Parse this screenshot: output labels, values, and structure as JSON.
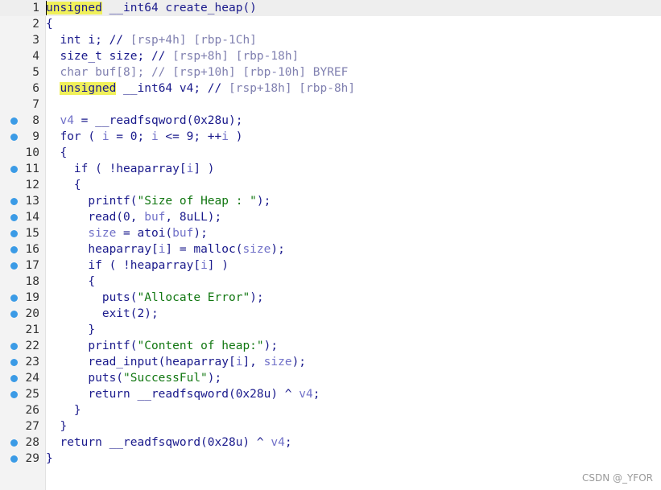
{
  "colors": {
    "gutter_bg": "#f3f3f3",
    "highlight": "#f0f05a",
    "keyword": "#1a1a8c",
    "variable": "#7070c8",
    "string": "#117711",
    "breakpoint": "#3b9be6"
  },
  "lines": [
    {
      "n": "1",
      "bp": false,
      "current": true,
      "parts": [
        [
          "hl",
          "unsigned"
        ],
        [
          "kw",
          " __int64 create_heap()"
        ]
      ]
    },
    {
      "n": "2",
      "bp": false,
      "parts": [
        [
          "kw",
          "{"
        ]
      ]
    },
    {
      "n": "3",
      "bp": false,
      "parts": [
        [
          "kw",
          "  int i; // "
        ],
        [
          "cm",
          "[rsp+4h] [rbp-1Ch]"
        ]
      ]
    },
    {
      "n": "4",
      "bp": false,
      "parts": [
        [
          "kw",
          "  size_t size; // "
        ],
        [
          "cm",
          "[rsp+8h] [rbp-18h]"
        ]
      ]
    },
    {
      "n": "5",
      "bp": false,
      "parts": [
        [
          "cm",
          "  char buf[8]; // [rsp+10h] [rbp-10h] BYREF"
        ]
      ]
    },
    {
      "n": "6",
      "bp": false,
      "parts": [
        [
          "kw",
          "  "
        ],
        [
          "hl",
          "unsigned"
        ],
        [
          "kw",
          " __int64 v4; // "
        ],
        [
          "cm",
          "[rsp+18h] [rbp-8h]"
        ]
      ]
    },
    {
      "n": "7",
      "bp": false,
      "parts": []
    },
    {
      "n": "8",
      "bp": true,
      "parts": [
        [
          "kw",
          "  "
        ],
        [
          "var",
          "v4"
        ],
        [
          "kw",
          " = __readfsqword(0x28u);"
        ]
      ]
    },
    {
      "n": "9",
      "bp": true,
      "parts": [
        [
          "kw",
          "  for ( "
        ],
        [
          "var",
          "i"
        ],
        [
          "kw",
          " = 0; "
        ],
        [
          "var",
          "i"
        ],
        [
          "kw",
          " <= 9; ++"
        ],
        [
          "var",
          "i"
        ],
        [
          "kw",
          " )"
        ]
      ]
    },
    {
      "n": "10",
      "bp": false,
      "parts": [
        [
          "kw",
          "  {"
        ]
      ]
    },
    {
      "n": "11",
      "bp": true,
      "parts": [
        [
          "kw",
          "    if ( !heaparray["
        ],
        [
          "var",
          "i"
        ],
        [
          "kw",
          "] )"
        ]
      ]
    },
    {
      "n": "12",
      "bp": false,
      "parts": [
        [
          "kw",
          "    {"
        ]
      ]
    },
    {
      "n": "13",
      "bp": true,
      "parts": [
        [
          "kw",
          "      printf("
        ],
        [
          "str",
          "\"Size of Heap : \""
        ],
        [
          "kw",
          ");"
        ]
      ]
    },
    {
      "n": "14",
      "bp": true,
      "parts": [
        [
          "kw",
          "      read(0, "
        ],
        [
          "var",
          "buf"
        ],
        [
          "kw",
          ", 8uLL);"
        ]
      ]
    },
    {
      "n": "15",
      "bp": true,
      "parts": [
        [
          "kw",
          "      "
        ],
        [
          "var",
          "size"
        ],
        [
          "kw",
          " = atoi("
        ],
        [
          "var",
          "buf"
        ],
        [
          "kw",
          ");"
        ]
      ]
    },
    {
      "n": "16",
      "bp": true,
      "parts": [
        [
          "kw",
          "      heaparray["
        ],
        [
          "var",
          "i"
        ],
        [
          "kw",
          "] = malloc("
        ],
        [
          "var",
          "size"
        ],
        [
          "kw",
          ");"
        ]
      ]
    },
    {
      "n": "17",
      "bp": true,
      "parts": [
        [
          "kw",
          "      if ( !heaparray["
        ],
        [
          "var",
          "i"
        ],
        [
          "kw",
          "] )"
        ]
      ]
    },
    {
      "n": "18",
      "bp": false,
      "parts": [
        [
          "kw",
          "      {"
        ]
      ]
    },
    {
      "n": "19",
      "bp": true,
      "parts": [
        [
          "kw",
          "        puts("
        ],
        [
          "str",
          "\"Allocate Error\""
        ],
        [
          "kw",
          ");"
        ]
      ]
    },
    {
      "n": "20",
      "bp": true,
      "parts": [
        [
          "kw",
          "        exit(2);"
        ]
      ]
    },
    {
      "n": "21",
      "bp": false,
      "parts": [
        [
          "kw",
          "      }"
        ]
      ]
    },
    {
      "n": "22",
      "bp": true,
      "parts": [
        [
          "kw",
          "      printf("
        ],
        [
          "str",
          "\"Content of heap:\""
        ],
        [
          "kw",
          ");"
        ]
      ]
    },
    {
      "n": "23",
      "bp": true,
      "parts": [
        [
          "kw",
          "      read_input(heaparray["
        ],
        [
          "var",
          "i"
        ],
        [
          "kw",
          "], "
        ],
        [
          "var",
          "size"
        ],
        [
          "kw",
          ");"
        ]
      ]
    },
    {
      "n": "24",
      "bp": true,
      "parts": [
        [
          "kw",
          "      puts("
        ],
        [
          "str",
          "\"SuccessFul\""
        ],
        [
          "kw",
          ");"
        ]
      ]
    },
    {
      "n": "25",
      "bp": true,
      "parts": [
        [
          "kw",
          "      return __readfsqword(0x28u) ^ "
        ],
        [
          "var",
          "v4"
        ],
        [
          "kw",
          ";"
        ]
      ]
    },
    {
      "n": "26",
      "bp": false,
      "parts": [
        [
          "kw",
          "    }"
        ]
      ]
    },
    {
      "n": "27",
      "bp": false,
      "parts": [
        [
          "kw",
          "  }"
        ]
      ]
    },
    {
      "n": "28",
      "bp": true,
      "parts": [
        [
          "kw",
          "  return __readfsqword(0x28u) ^ "
        ],
        [
          "var",
          "v4"
        ],
        [
          "kw",
          ";"
        ]
      ]
    },
    {
      "n": "29",
      "bp": true,
      "parts": [
        [
          "kw",
          "}"
        ]
      ]
    }
  ],
  "watermark": "CSDN @_YFOR"
}
